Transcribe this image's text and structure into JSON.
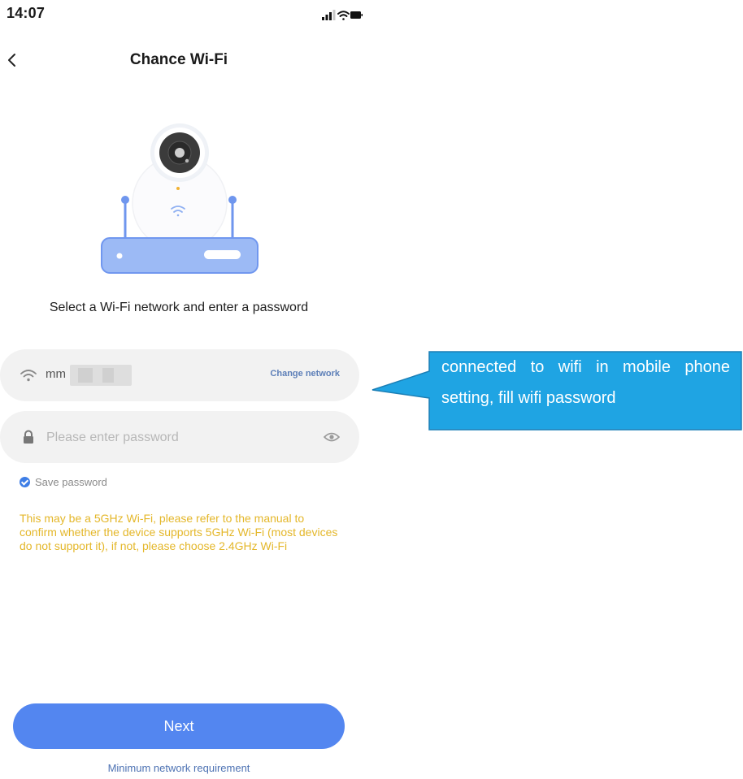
{
  "status_bar": {
    "time": "14:07"
  },
  "header": {
    "title": "Chance Wi-Fi"
  },
  "prompt": "Select a Wi-Fi network and enter a password",
  "wifi_field": {
    "value": "mm",
    "change_label": "Change network"
  },
  "password_field": {
    "placeholder": "Please enter password"
  },
  "save_password": {
    "label": "Save password",
    "checked": true
  },
  "warning": "This may be a 5GHz Wi-Fi, please refer to the manual to confirm whether the device supports 5GHz Wi-Fi (most devices do not support it), if not, please choose 2.4GHz Wi-Fi",
  "next_button": {
    "label": "Next"
  },
  "min_requirement_link": "Minimum network requirement",
  "annotation": {
    "text": "connected to wifi in mobile phone setting, fill wifi password"
  },
  "colors": {
    "primary": "#5386f0",
    "warning": "#e4b72a",
    "link": "#4d72b3",
    "callout": "#1fa4e3",
    "field_bg": "#f2f2f2"
  }
}
